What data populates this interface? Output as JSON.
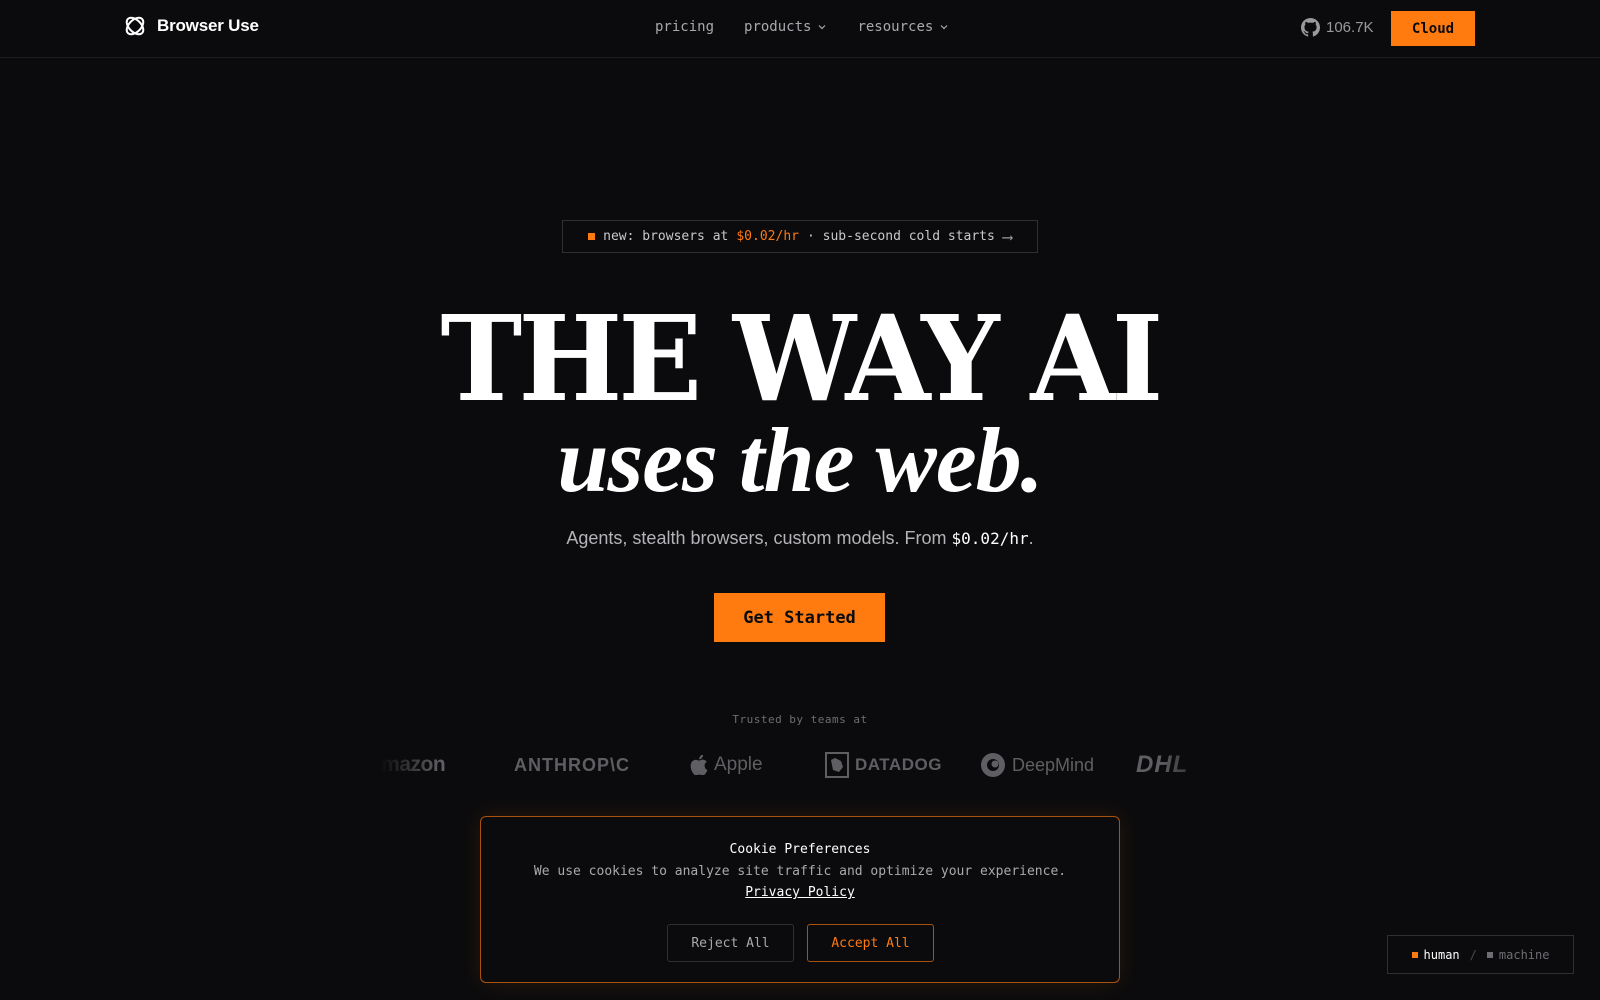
{
  "nav": {
    "brand": "Browser Use",
    "links": [
      {
        "label": "pricing"
      },
      {
        "label": "products"
      },
      {
        "label": "resources"
      }
    ],
    "github_stars": "106.7K",
    "cloud_button": "Cloud"
  },
  "announcement": {
    "prefix": "new: browsers at",
    "price": "$0.02/hr",
    "suffix": "· sub-second cold starts",
    "arrow": "⟶"
  },
  "hero": {
    "headline_line1": "THE WAY AI",
    "headline_line2": "uses the web.",
    "subtitle_text": "Agents, stealth browsers, custom models. From ",
    "subtitle_price": "$0.02/hr",
    "subtitle_end": ".",
    "cta": "Get Started"
  },
  "trusted": {
    "label": "Trusted by teams at",
    "logos": [
      "amazon",
      "ANTHROP\\C",
      "Apple",
      "DATADOG",
      "DeepMind",
      "DHL"
    ]
  },
  "cookie": {
    "title": "Cookie Preferences",
    "text": "We use cookies to analyze site traffic and optimize your experience.",
    "link": "Privacy Policy",
    "reject": "Reject All",
    "accept": "Accept All"
  },
  "mode_toggle": {
    "human": "human",
    "separator": "/",
    "machine": "machine"
  },
  "colors": {
    "background": "#0b0b0d",
    "accent": "#ff7a0f",
    "text": "#ffffff",
    "muted": "#a9a9ad"
  }
}
